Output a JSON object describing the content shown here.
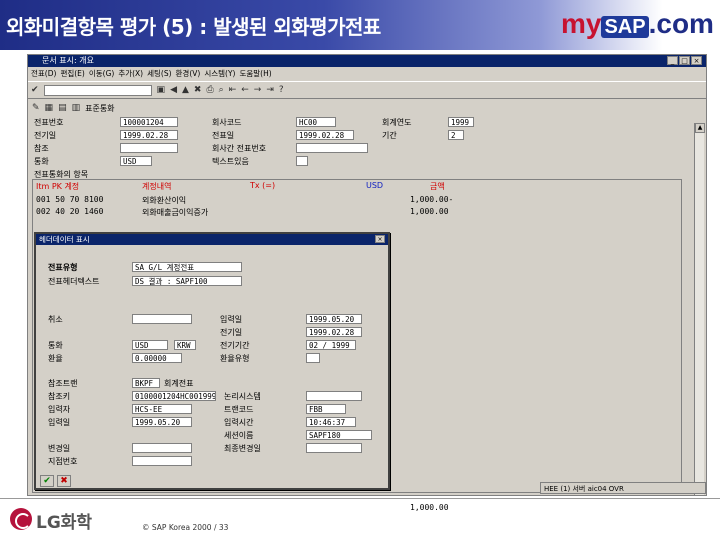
{
  "slide": {
    "title": "외화미결항목 평가 (5) : 발생된 외화평가전표",
    "logo": {
      "my": "my",
      "sap": "SAP",
      "com": ".com"
    },
    "footer": {
      "company": "LG화학",
      "copyright": "©  SAP Korea 2000 / 33"
    }
  },
  "window": {
    "title": "문서 표시: 개요",
    "menu": [
      "전표(D)",
      "편집(E)",
      "이동(G)",
      "추가(X)",
      "세팅(S)",
      "환경(V)",
      "시스템(Y)",
      "도움말(H)"
    ],
    "toolbar2_label": "표준통화"
  },
  "form": {
    "doc_number_label": "전표번호",
    "doc_number": "100001204",
    "posting_date_label": "전기일",
    "posting_date": "1999.02.28",
    "ref_label": "참조",
    "ref": "",
    "currency_label": "통화",
    "currency": "USD",
    "company_label": "회사코드",
    "company": "HC00",
    "doc_date_label": "전표일",
    "doc_date": "1999.02.28",
    "fiscal_year_label": "회계연도",
    "fiscal_year": "1999",
    "period_label": "기간",
    "period": "2",
    "cross_company_label": "회사간 전표번호",
    "cross_company": "",
    "text_label": "텍스트있음",
    "text": ""
  },
  "grid": {
    "title": "전표통화의 항목",
    "headers": {
      "item": "Itm PK 계정",
      "desc": "계정내역",
      "tax": "Tx (=)",
      "currency": "USD",
      "amount": "금액"
    },
    "rows": [
      {
        "item": "001 50 70 8100",
        "desc": "외화환산이익",
        "amount": "1,000.00-"
      },
      {
        "item": "002 40 20 1460",
        "desc": "외화매출금이익증가",
        "amount": "1,000.00"
      }
    ],
    "extra_amount": "1,000.00",
    "status": "HEE (1) 서버 aic04 OVR"
  },
  "dialog": {
    "title": "헤더데이터 표시",
    "fields": {
      "doc_type_label": "전표유형",
      "doc_type": "SA G/L 계정전표",
      "header_text_label": "전표헤더텍스트",
      "header_text": "DS 결과 : SAPF100",
      "reversal_label": "취소",
      "reversal": "",
      "entry_date_label": "입력일",
      "entry_date": "1999.05.20",
      "posting_date_label": "전기일",
      "posting_date": "1999.02.28",
      "posting_period_label": "전기기간",
      "posting_period": "02 / 1999",
      "currency_label": "통화",
      "currency": "USD",
      "curr2": "KRW",
      "exchange_label": "환율",
      "exchange": "0.00000",
      "rate_type_label": "환율유형",
      "rate_type": "",
      "ref_trans_label": "참조트랜",
      "ref_trans": "BKPF",
      "ref_trans_text": "회계전표",
      "ref_key_label": "참조키",
      "ref_key": "0100001204HC001999",
      "logical_sys_label": "논리시스템",
      "logical_sys": "",
      "entered_by_label": "입력자",
      "entered_by": "HCS-EE",
      "entry_date2_label": "입력일",
      "entry_date2": "1999.05.20",
      "tcode_label": "트랜코드",
      "tcode": "FBB",
      "entry_time_label": "입력시간",
      "entry_time": "10:46:37",
      "session_label": "세션이름",
      "session": "SAPF180",
      "change_label": "변경일",
      "change": "",
      "last_change_label": "최종변경일",
      "last_change": "",
      "reference_label": "참조키",
      "reference": "",
      "branch_label": "지점번호",
      "branch": ""
    }
  }
}
